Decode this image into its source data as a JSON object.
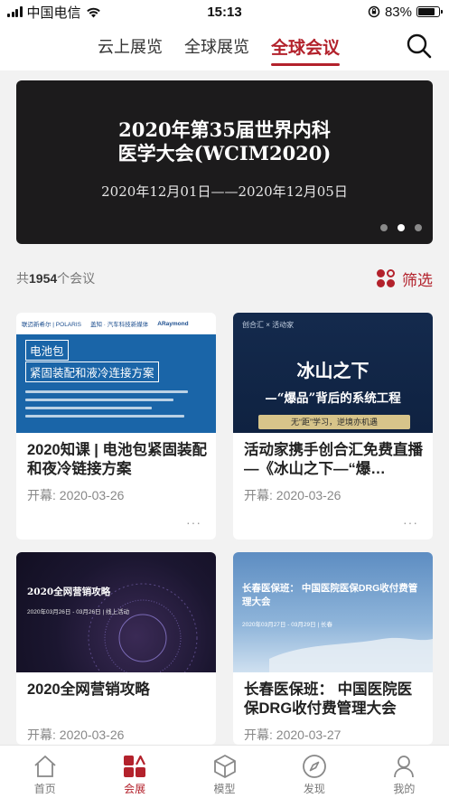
{
  "status_bar": {
    "carrier": "中国电信",
    "time": "15:13",
    "battery": "83%"
  },
  "top_tabs": [
    {
      "label": "云上展览",
      "active": false
    },
    {
      "label": "全球展览",
      "active": false
    },
    {
      "label": "全球会议",
      "active": true
    }
  ],
  "banner": {
    "title": "2020年第35届世界内科\n医学大会(WCIM2020)",
    "date": "2020年12月01日——2020年12月05日",
    "slides": 3,
    "active_slide": 2
  },
  "summary": {
    "prefix": "共",
    "count": "1954",
    "suffix": "个会议",
    "filter_label": "筛选"
  },
  "cards": [
    {
      "title": "2020知课 | 电池包紧固装配和夜冷链接方案",
      "date_label": "开幕: 2020-03-26",
      "more": "···",
      "poster": {
        "brands": [
          "联迈新希尔 | POLARIS",
          "盖知 · 汽车科技新媒体",
          "ARaymond"
        ],
        "tag1": "电池包",
        "tag2": "紧固装配和液冷连接方案"
      }
    },
    {
      "title": "活动家携手创合汇免费直播—《冰山之下—“爆…",
      "date_label": "开幕: 2020-03-26",
      "more": "···",
      "poster": {
        "header": "创合汇 × 活动家",
        "big": "冰山之下",
        "sub": "—“爆品”背后的系统工程",
        "bar": "无“距”学习，逆境亦机遇"
      }
    },
    {
      "title": "2020全网营销攻略",
      "date_label": "开幕: 2020-03-26",
      "more": "···",
      "poster": {
        "title": "2020全网营销攻略",
        "sub": "2020年03月26日 - 03月26日 | 线上活动"
      }
    },
    {
      "title": "长春医保班： 中国医院医保DRG收付费管理大会",
      "date_label": "开幕: 2020-03-27",
      "more": "···",
      "poster": {
        "title": "长春医保班： 中国医院医保DRG收付费管理大会",
        "sub": "2020年03月27日 - 03月29日 | 长春"
      }
    }
  ],
  "bottom_nav": [
    {
      "label": "首页",
      "icon": "home-icon",
      "active": false
    },
    {
      "label": "会展",
      "icon": "expo-icon",
      "active": true
    },
    {
      "label": "模型",
      "icon": "cube-icon",
      "active": false
    },
    {
      "label": "发现",
      "icon": "compass-icon",
      "active": false
    },
    {
      "label": "我的",
      "icon": "user-icon",
      "active": false
    }
  ],
  "colors": {
    "accent": "#b3222c",
    "banner_bg": "#1c1b1c",
    "page_bg": "#f2f2f2"
  }
}
